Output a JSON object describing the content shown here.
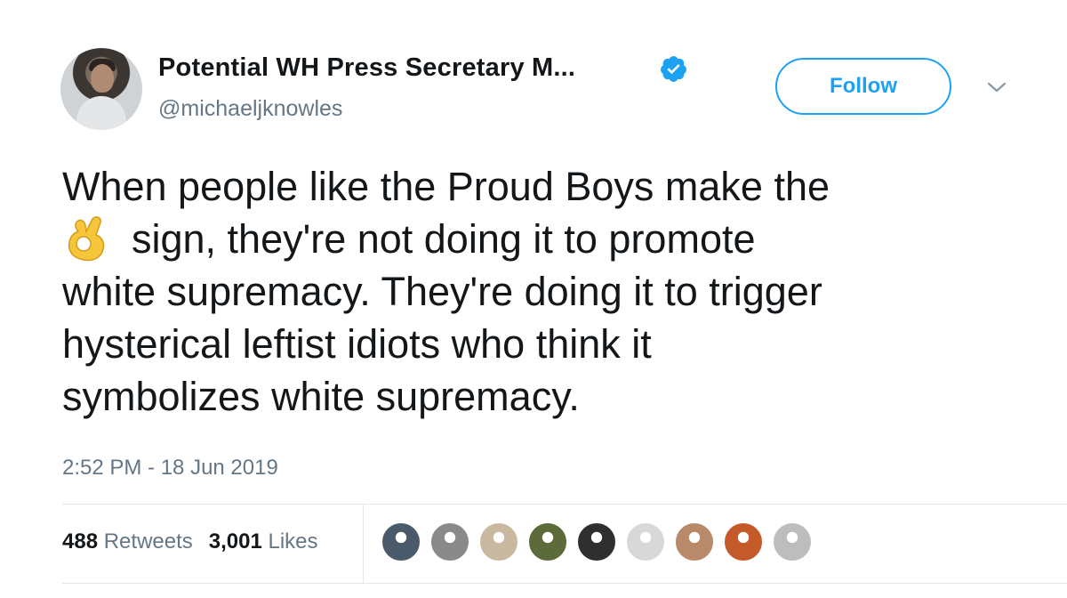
{
  "author": {
    "display_name": "Potential WH Press Secretary M...",
    "handle": "@michaeljknowles",
    "verified": true,
    "avatar_icon": "profile-photo"
  },
  "actions": {
    "follow_label": "Follow",
    "menu_icon": "chevron-down-icon",
    "accent_color": "#1da1f2"
  },
  "tweet": {
    "line1": "When people like the Proud Boys make the",
    "emoji": "ok-hand-icon",
    "line2": "sign, they're not doing it to promote",
    "line3": "white supremacy. They're doing it to trigger",
    "line4": "hysterical leftist idiots who think it",
    "line5": "symbolizes white supremacy."
  },
  "timestamp": "2:52 PM - 18 Jun 2019",
  "stats": {
    "retweets_count": "488",
    "retweets_label": "Retweets",
    "likes_count": "3,001",
    "likes_label": "Likes"
  },
  "likers": [
    {
      "name": "liker-avatar-1",
      "color": "#4a5a6a"
    },
    {
      "name": "liker-avatar-2",
      "color": "#8a8a8a"
    },
    {
      "name": "liker-avatar-3",
      "color": "#c9b9a0"
    },
    {
      "name": "liker-avatar-4",
      "color": "#5d6b3a"
    },
    {
      "name": "liker-avatar-5",
      "color": "#2f2f2f"
    },
    {
      "name": "liker-avatar-6",
      "color": "#d8d8d8"
    },
    {
      "name": "liker-avatar-7",
      "color": "#b88a6a"
    },
    {
      "name": "liker-avatar-8",
      "color": "#c45a2a"
    },
    {
      "name": "liker-avatar-9",
      "color": "#bdbdbd"
    }
  ]
}
